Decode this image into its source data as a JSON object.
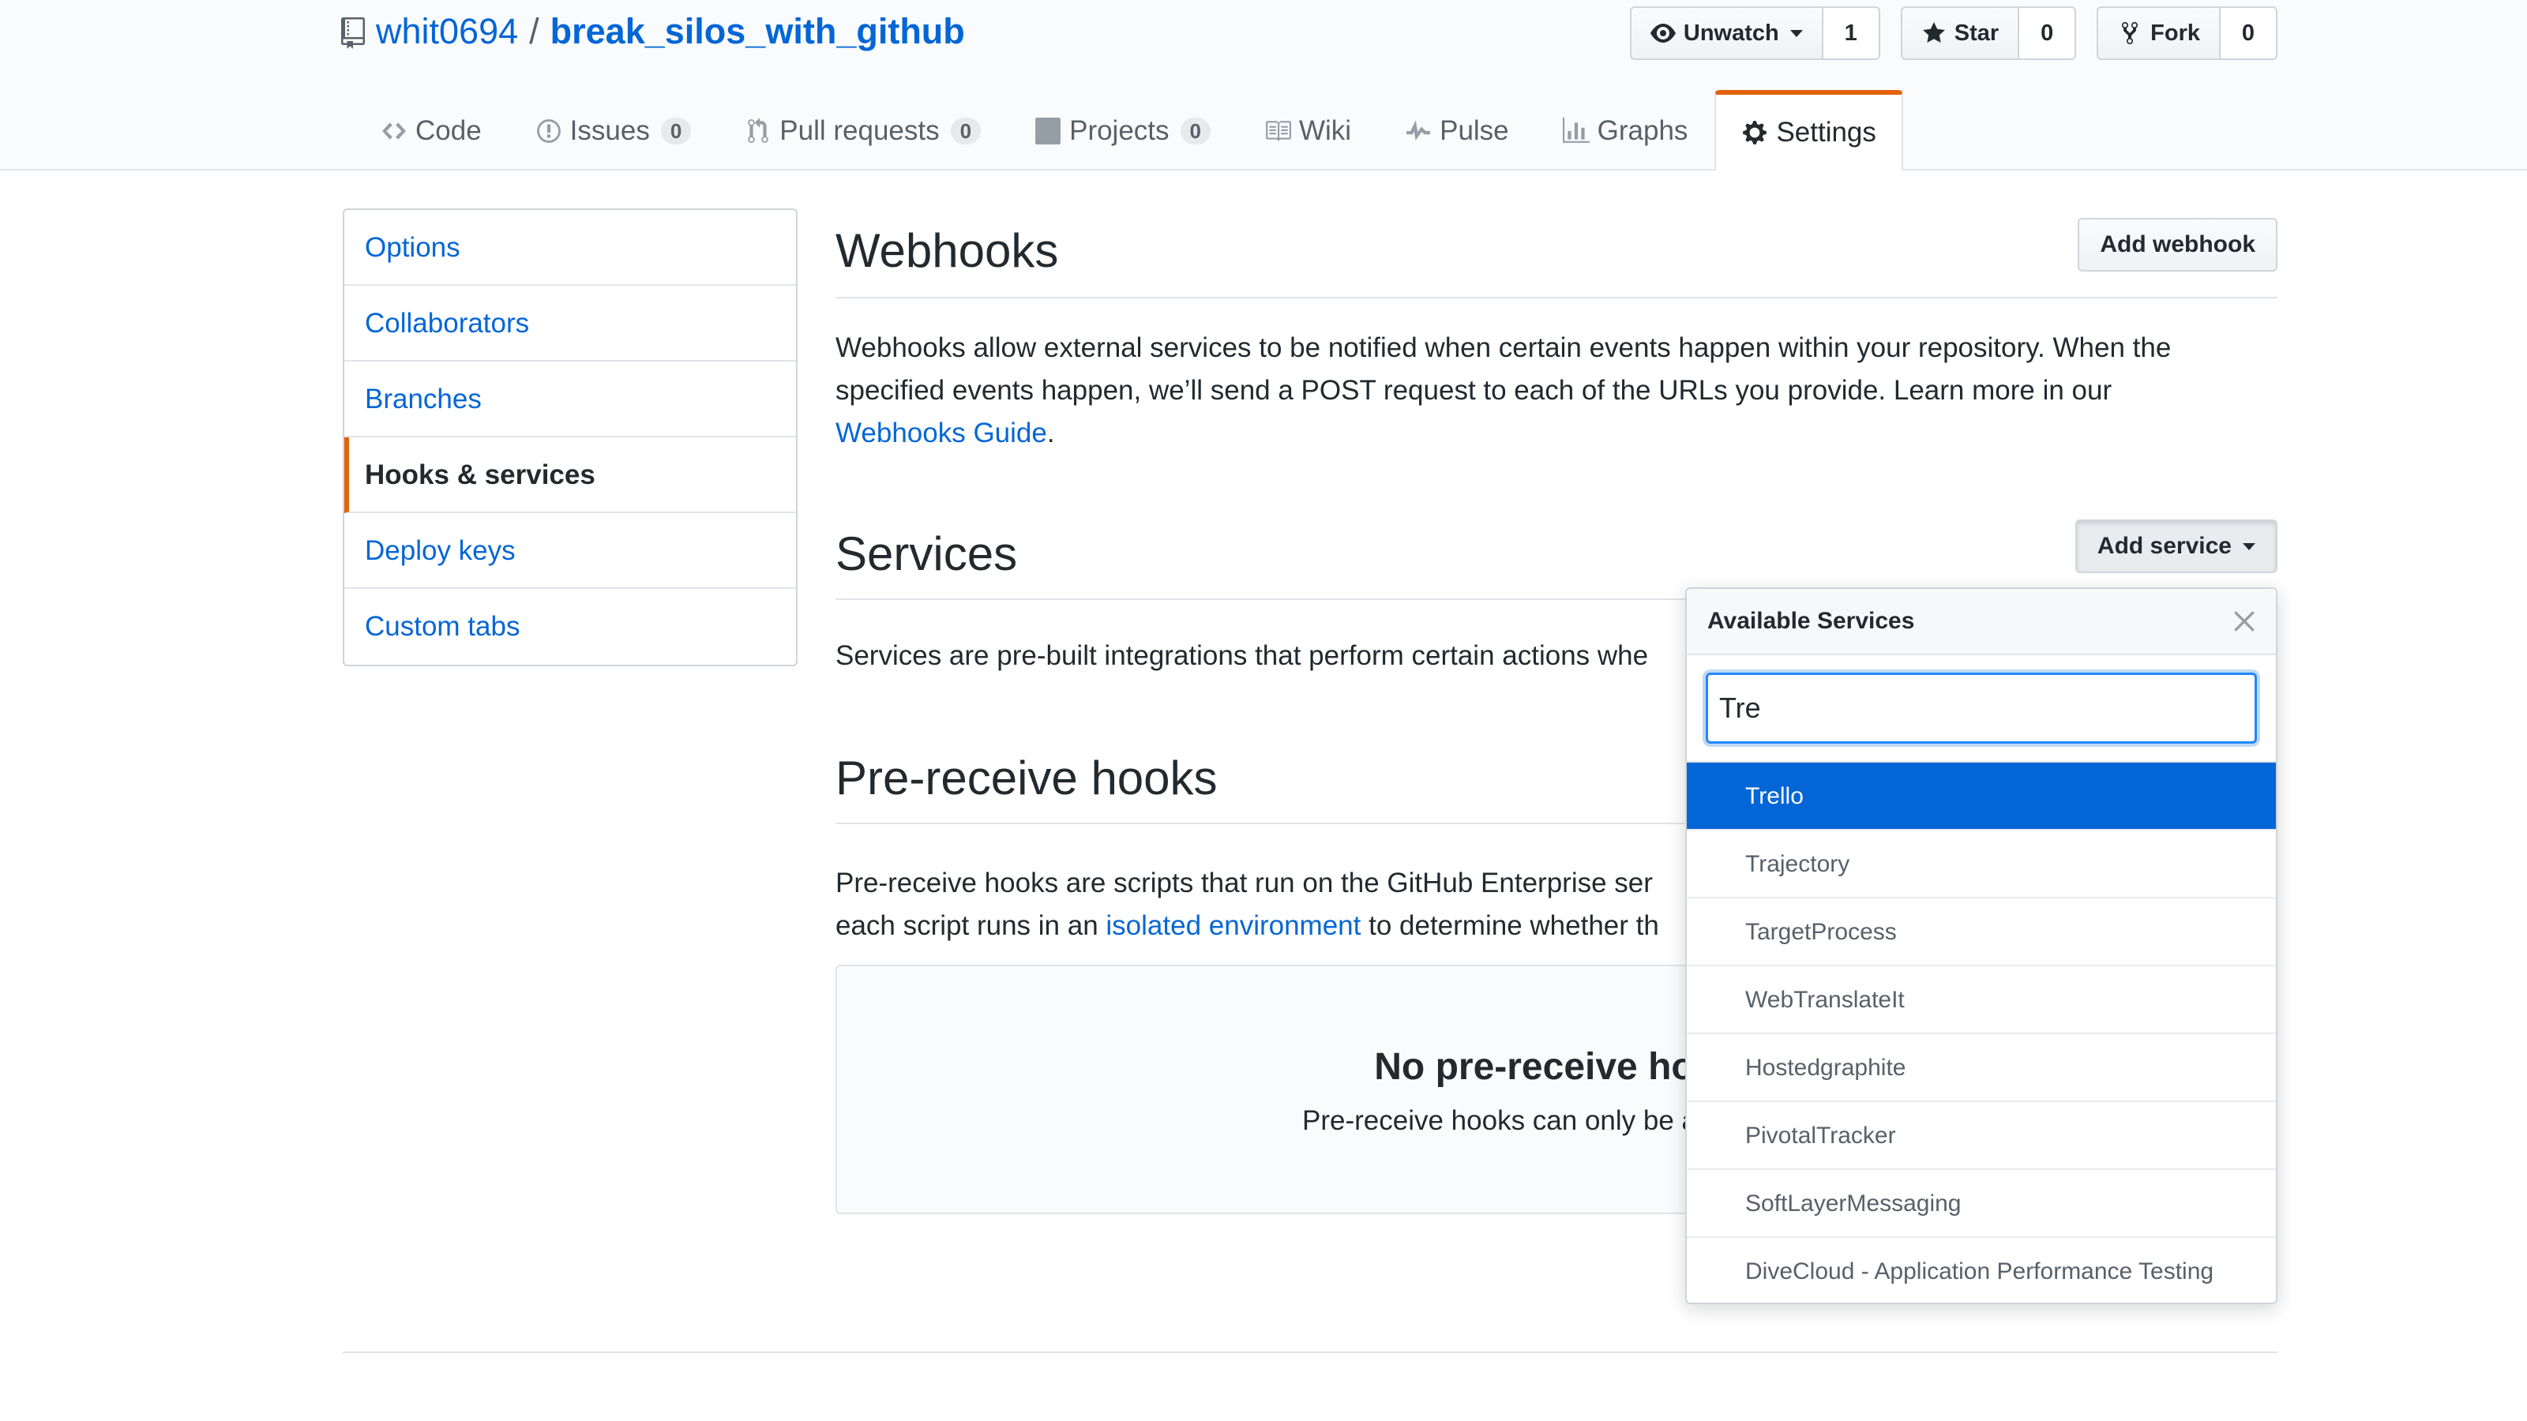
{
  "repo": {
    "owner": "whit0694",
    "separator": "/",
    "name": "break_silos_with_github"
  },
  "actions": {
    "watch": {
      "label": "Unwatch",
      "count": "1"
    },
    "star": {
      "label": "Star",
      "count": "0"
    },
    "fork": {
      "label": "Fork",
      "count": "0"
    }
  },
  "tabs": [
    {
      "label": "Code",
      "icon": "code-icon"
    },
    {
      "label": "Issues",
      "counter": "0",
      "icon": "issue-icon"
    },
    {
      "label": "Pull requests",
      "counter": "0",
      "icon": "pull-request-icon"
    },
    {
      "label": "Projects",
      "counter": "0",
      "icon": "project-icon"
    },
    {
      "label": "Wiki",
      "icon": "book-icon"
    },
    {
      "label": "Pulse",
      "icon": "pulse-icon"
    },
    {
      "label": "Graphs",
      "icon": "graph-icon"
    },
    {
      "label": "Settings",
      "icon": "gear-icon",
      "selected": true
    }
  ],
  "sidebar": {
    "items": [
      {
        "label": "Options"
      },
      {
        "label": "Collaborators"
      },
      {
        "label": "Branches"
      },
      {
        "label": "Hooks & services",
        "selected": true
      },
      {
        "label": "Deploy keys"
      },
      {
        "label": "Custom tabs"
      }
    ]
  },
  "webhooks": {
    "title": "Webhooks",
    "button": "Add webhook",
    "desc_line1": "Webhooks allow external services to be notified when certain events happen within your repository. When the",
    "desc_line2": "specified events happen, we’ll send a POST request to each of the URLs you provide. Learn more in our",
    "guide_link": "Webhooks Guide",
    "period": "."
  },
  "services": {
    "title": "Services",
    "button": "Add service",
    "desc": "Services are pre-built integrations that perform certain actions whe"
  },
  "prereceive": {
    "title": "Pre-receive hooks",
    "desc_line1": "Pre-receive hooks are scripts that run on the GitHub Enterprise ser",
    "desc_line2_before": "each script runs in an",
    "desc_link": "isolated environment",
    "desc_line2_after": "to determine whether th",
    "blank_title": "No pre-receive hook",
    "blank_text": "Pre-receive hooks can only be added by t"
  },
  "dropdown": {
    "title": "Available Services",
    "filter_value": "Tre",
    "items": [
      {
        "label": "Trello",
        "selected": true
      },
      {
        "label": "Trajectory"
      },
      {
        "label": "TargetProcess"
      },
      {
        "label": "WebTranslateIt"
      },
      {
        "label": "Hostedgraphite"
      },
      {
        "label": "PivotalTracker"
      },
      {
        "label": "SoftLayerMessaging"
      },
      {
        "label": "DiveCloud - Application Performance Testing"
      }
    ]
  },
  "colors": {
    "link": "#0366d6",
    "accent_orange": "#e36209",
    "selected_bg": "#0366d6",
    "focus_border": "#2188ff"
  }
}
